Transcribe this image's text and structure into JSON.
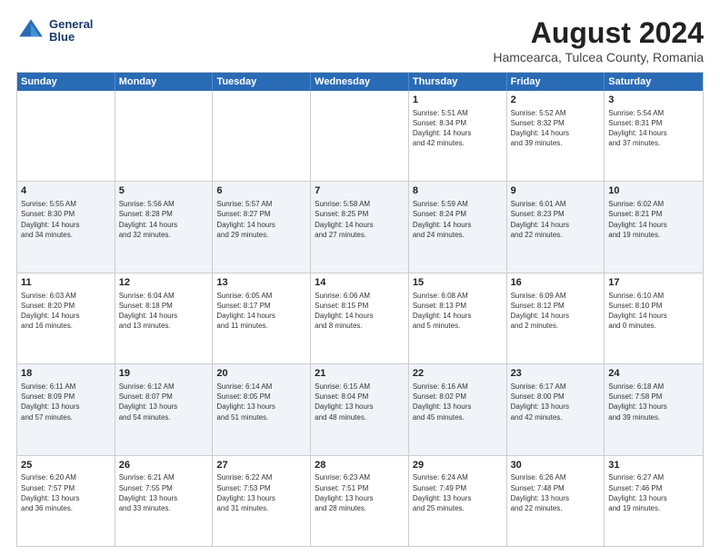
{
  "header": {
    "logo_line1": "General",
    "logo_line2": "Blue",
    "main_title": "August 2024",
    "subtitle": "Hamcearca, Tulcea County, Romania"
  },
  "days_of_week": [
    "Sunday",
    "Monday",
    "Tuesday",
    "Wednesday",
    "Thursday",
    "Friday",
    "Saturday"
  ],
  "rows": [
    [
      {
        "day": "",
        "text": ""
      },
      {
        "day": "",
        "text": ""
      },
      {
        "day": "",
        "text": ""
      },
      {
        "day": "",
        "text": ""
      },
      {
        "day": "1",
        "text": "Sunrise: 5:51 AM\nSunset: 8:34 PM\nDaylight: 14 hours\nand 42 minutes."
      },
      {
        "day": "2",
        "text": "Sunrise: 5:52 AM\nSunset: 8:32 PM\nDaylight: 14 hours\nand 39 minutes."
      },
      {
        "day": "3",
        "text": "Sunrise: 5:54 AM\nSunset: 8:31 PM\nDaylight: 14 hours\nand 37 minutes."
      }
    ],
    [
      {
        "day": "4",
        "text": "Sunrise: 5:55 AM\nSunset: 8:30 PM\nDaylight: 14 hours\nand 34 minutes."
      },
      {
        "day": "5",
        "text": "Sunrise: 5:56 AM\nSunset: 8:28 PM\nDaylight: 14 hours\nand 32 minutes."
      },
      {
        "day": "6",
        "text": "Sunrise: 5:57 AM\nSunset: 8:27 PM\nDaylight: 14 hours\nand 29 minutes."
      },
      {
        "day": "7",
        "text": "Sunrise: 5:58 AM\nSunset: 8:25 PM\nDaylight: 14 hours\nand 27 minutes."
      },
      {
        "day": "8",
        "text": "Sunrise: 5:59 AM\nSunset: 8:24 PM\nDaylight: 14 hours\nand 24 minutes."
      },
      {
        "day": "9",
        "text": "Sunrise: 6:01 AM\nSunset: 8:23 PM\nDaylight: 14 hours\nand 22 minutes."
      },
      {
        "day": "10",
        "text": "Sunrise: 6:02 AM\nSunset: 8:21 PM\nDaylight: 14 hours\nand 19 minutes."
      }
    ],
    [
      {
        "day": "11",
        "text": "Sunrise: 6:03 AM\nSunset: 8:20 PM\nDaylight: 14 hours\nand 16 minutes."
      },
      {
        "day": "12",
        "text": "Sunrise: 6:04 AM\nSunset: 8:18 PM\nDaylight: 14 hours\nand 13 minutes."
      },
      {
        "day": "13",
        "text": "Sunrise: 6:05 AM\nSunset: 8:17 PM\nDaylight: 14 hours\nand 11 minutes."
      },
      {
        "day": "14",
        "text": "Sunrise: 6:06 AM\nSunset: 8:15 PM\nDaylight: 14 hours\nand 8 minutes."
      },
      {
        "day": "15",
        "text": "Sunrise: 6:08 AM\nSunset: 8:13 PM\nDaylight: 14 hours\nand 5 minutes."
      },
      {
        "day": "16",
        "text": "Sunrise: 6:09 AM\nSunset: 8:12 PM\nDaylight: 14 hours\nand 2 minutes."
      },
      {
        "day": "17",
        "text": "Sunrise: 6:10 AM\nSunset: 8:10 PM\nDaylight: 14 hours\nand 0 minutes."
      }
    ],
    [
      {
        "day": "18",
        "text": "Sunrise: 6:11 AM\nSunset: 8:09 PM\nDaylight: 13 hours\nand 57 minutes."
      },
      {
        "day": "19",
        "text": "Sunrise: 6:12 AM\nSunset: 8:07 PM\nDaylight: 13 hours\nand 54 minutes."
      },
      {
        "day": "20",
        "text": "Sunrise: 6:14 AM\nSunset: 8:05 PM\nDaylight: 13 hours\nand 51 minutes."
      },
      {
        "day": "21",
        "text": "Sunrise: 6:15 AM\nSunset: 8:04 PM\nDaylight: 13 hours\nand 48 minutes."
      },
      {
        "day": "22",
        "text": "Sunrise: 6:16 AM\nSunset: 8:02 PM\nDaylight: 13 hours\nand 45 minutes."
      },
      {
        "day": "23",
        "text": "Sunrise: 6:17 AM\nSunset: 8:00 PM\nDaylight: 13 hours\nand 42 minutes."
      },
      {
        "day": "24",
        "text": "Sunrise: 6:18 AM\nSunset: 7:58 PM\nDaylight: 13 hours\nand 39 minutes."
      }
    ],
    [
      {
        "day": "25",
        "text": "Sunrise: 6:20 AM\nSunset: 7:57 PM\nDaylight: 13 hours\nand 36 minutes."
      },
      {
        "day": "26",
        "text": "Sunrise: 6:21 AM\nSunset: 7:55 PM\nDaylight: 13 hours\nand 33 minutes."
      },
      {
        "day": "27",
        "text": "Sunrise: 6:22 AM\nSunset: 7:53 PM\nDaylight: 13 hours\nand 31 minutes."
      },
      {
        "day": "28",
        "text": "Sunrise: 6:23 AM\nSunset: 7:51 PM\nDaylight: 13 hours\nand 28 minutes."
      },
      {
        "day": "29",
        "text": "Sunrise: 6:24 AM\nSunset: 7:49 PM\nDaylight: 13 hours\nand 25 minutes."
      },
      {
        "day": "30",
        "text": "Sunrise: 6:26 AM\nSunset: 7:48 PM\nDaylight: 13 hours\nand 22 minutes."
      },
      {
        "day": "31",
        "text": "Sunrise: 6:27 AM\nSunset: 7:46 PM\nDaylight: 13 hours\nand 19 minutes."
      }
    ]
  ]
}
